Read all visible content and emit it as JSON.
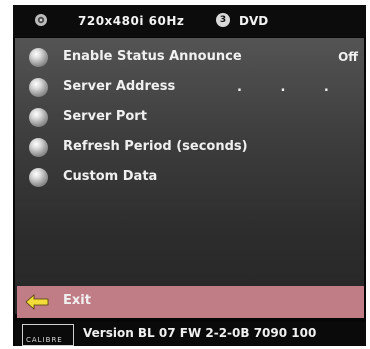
{
  "status_bar": {
    "disc_icon": "disc-icon",
    "resolution": "720x480i 60Hz",
    "source_icon": "numbered-circle-icon",
    "source_icon_number": "3",
    "source": "DVD"
  },
  "menu": {
    "items": [
      {
        "label": "Enable Status Announce",
        "value": "Off"
      },
      {
        "label": "Server Address",
        "value": ". . ."
      },
      {
        "label": "Server Port",
        "value": ""
      },
      {
        "label": "Refresh Period (seconds)",
        "value": ""
      },
      {
        "label": "Custom Data",
        "value": ""
      }
    ],
    "exit_label": "Exit",
    "exit_icon": "left-arrow-icon",
    "highlight_color": "#c07d86"
  },
  "footer": {
    "logo_text": "CALIBRE",
    "version": "Version BL 07 FW 2-2-0B 7090 100"
  }
}
